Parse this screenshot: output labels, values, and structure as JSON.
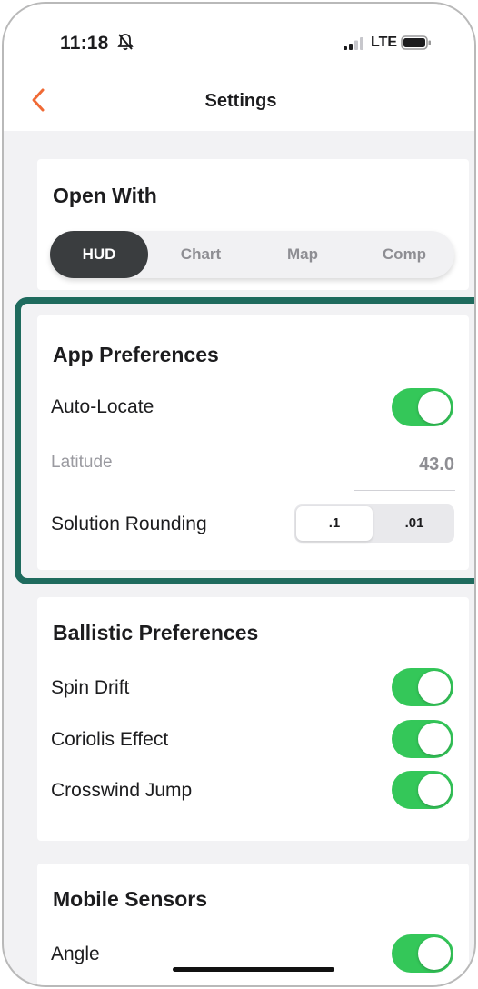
{
  "status_bar": {
    "time": "11:18",
    "network": "LTE",
    "icons": [
      "bell-muted-icon",
      "signal-icon",
      "battery-icon"
    ]
  },
  "nav": {
    "title": "Settings",
    "back_icon": "chevron-left-icon"
  },
  "open_with": {
    "title": "Open With",
    "options": [
      "HUD",
      "Chart",
      "Map",
      "Comp"
    ],
    "selected": "HUD"
  },
  "app_preferences": {
    "title": "App Preferences",
    "auto_locate": {
      "label": "Auto-Locate",
      "on": true
    },
    "latitude": {
      "label": "Latitude",
      "value": "43.0"
    },
    "solution_rounding": {
      "label": "Solution Rounding",
      "options": [
        ".1",
        ".01"
      ],
      "selected": ".1"
    }
  },
  "ballistic_preferences": {
    "title": "Ballistic Preferences",
    "items": [
      {
        "label": "Spin Drift",
        "on": true
      },
      {
        "label": "Coriolis Effect",
        "on": true
      },
      {
        "label": "Crosswind Jump",
        "on": true
      }
    ]
  },
  "mobile_sensors": {
    "title": "Mobile Sensors",
    "items": [
      {
        "label": "Angle",
        "on": true
      }
    ]
  },
  "colors": {
    "accent": "#f06a35",
    "toggle_on": "#34c759",
    "segment_active": "#3a3d3f",
    "highlight_border": "#1f6b5e",
    "background": "#f2f2f4"
  }
}
